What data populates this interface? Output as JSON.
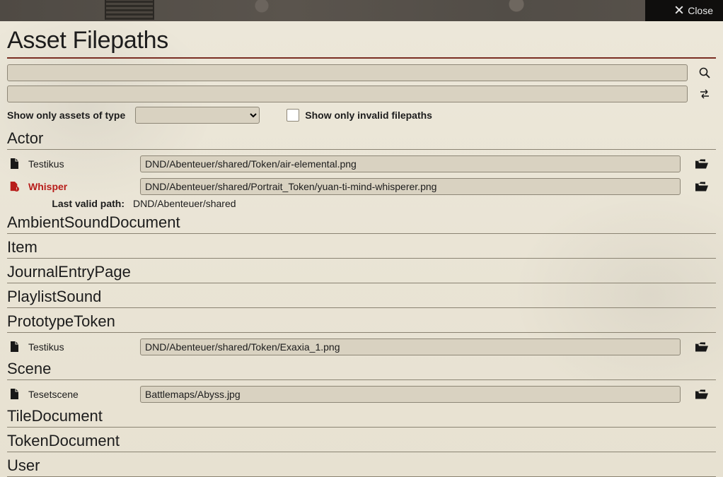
{
  "close_label": "Close",
  "title": "Asset Filepaths",
  "search_value": "",
  "replace_value": "",
  "filter_label": "Show only assets of type",
  "type_selected": "",
  "invalid_only_label": "Show only invalid filepaths",
  "invalid_only_checked": false,
  "last_valid_label": "Last valid path:",
  "sections": {
    "actor": {
      "heading": "Actor",
      "rows": {
        "testikus": {
          "name": "Testikus",
          "path": "DND/Abenteuer/shared/Token/air-elemental.png",
          "invalid": false
        },
        "whisper": {
          "name": "Whisper",
          "path": "DND/Abenteuer/shared/Portrait_Token/yuan-ti-mind-whisperer.png",
          "invalid": true,
          "last_valid": "DND/Abenteuer/shared"
        }
      }
    },
    "ambientSound": {
      "heading": "AmbientSoundDocument"
    },
    "item": {
      "heading": "Item"
    },
    "journal": {
      "heading": "JournalEntryPage"
    },
    "playlist": {
      "heading": "PlaylistSound"
    },
    "prototype": {
      "heading": "PrototypeToken",
      "rows": {
        "testikus": {
          "name": "Testikus",
          "path": "DND/Abenteuer/shared/Token/Exaxia_1.png",
          "invalid": false
        }
      }
    },
    "scene": {
      "heading": "Scene",
      "rows": {
        "tesetscene": {
          "name": "Tesetscene",
          "path": "Battlemaps/Abyss.jpg",
          "invalid": false
        }
      }
    },
    "tileDoc": {
      "heading": "TileDocument"
    },
    "tokenDoc": {
      "heading": "TokenDocument"
    },
    "user": {
      "heading": "User"
    }
  },
  "icons": {
    "close": "close-icon",
    "search": "search-icon",
    "swap": "swap-icon",
    "file": "file-icon",
    "file_invalid": "file-warning-icon",
    "folder": "folder-open-icon"
  }
}
